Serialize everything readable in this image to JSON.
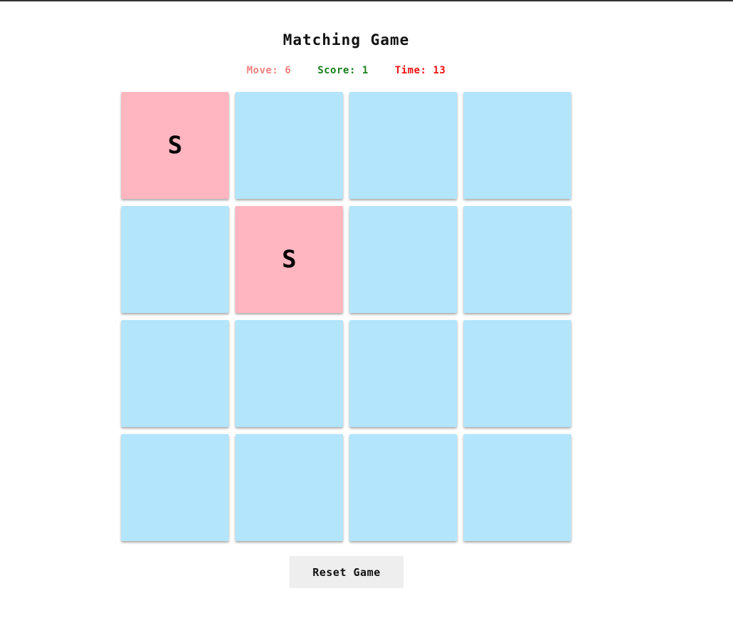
{
  "game": {
    "title": "Matching Game",
    "stats": {
      "move_label": "Move:",
      "move_value": "6",
      "score_label": "Score:",
      "score_value": "1",
      "time_label": "Time:",
      "time_value": "13"
    },
    "colors": {
      "move": "#f08080",
      "score": "#1a7f1a",
      "time": "#ee1111",
      "card_hidden": "#b3e5fc",
      "card_revealed": "#ffb6c1"
    },
    "board": {
      "rows": 4,
      "cols": 4,
      "cards": [
        {
          "state": "revealed",
          "symbol": "S"
        },
        {
          "state": "hidden",
          "symbol": ""
        },
        {
          "state": "hidden",
          "symbol": ""
        },
        {
          "state": "hidden",
          "symbol": ""
        },
        {
          "state": "hidden",
          "symbol": ""
        },
        {
          "state": "revealed",
          "symbol": "S"
        },
        {
          "state": "hidden",
          "symbol": ""
        },
        {
          "state": "hidden",
          "symbol": ""
        },
        {
          "state": "hidden",
          "symbol": ""
        },
        {
          "state": "hidden",
          "symbol": ""
        },
        {
          "state": "hidden",
          "symbol": ""
        },
        {
          "state": "hidden",
          "symbol": ""
        },
        {
          "state": "hidden",
          "symbol": ""
        },
        {
          "state": "hidden",
          "symbol": ""
        },
        {
          "state": "hidden",
          "symbol": ""
        },
        {
          "state": "hidden",
          "symbol": ""
        }
      ]
    },
    "reset_label": "Reset Game"
  }
}
